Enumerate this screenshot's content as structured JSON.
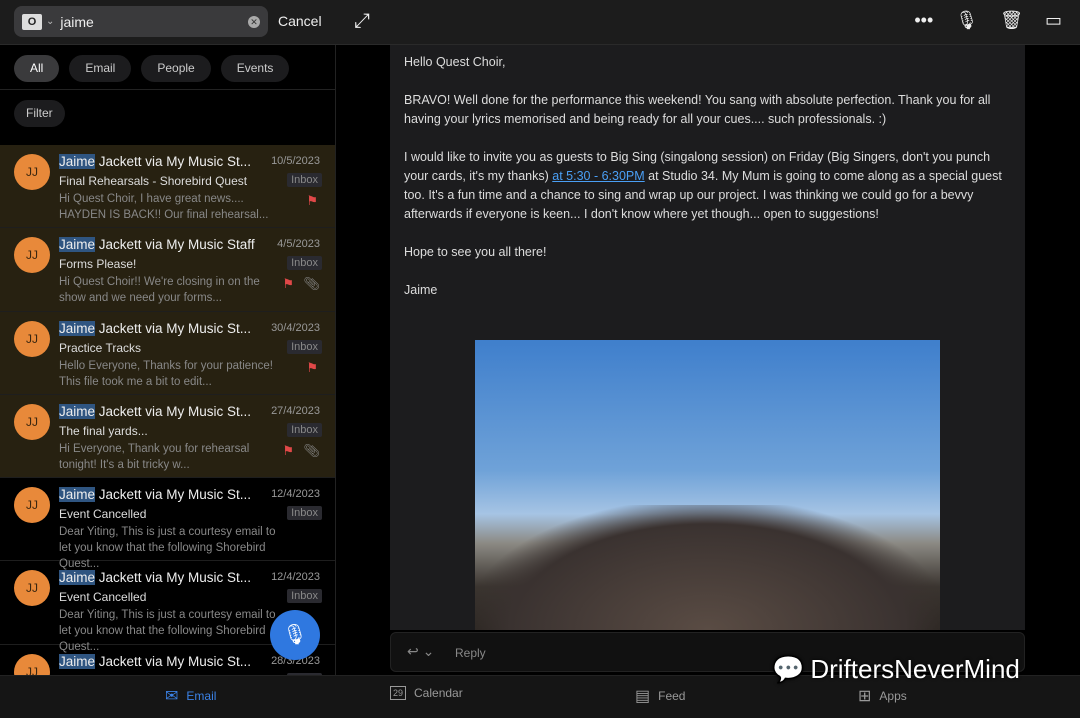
{
  "search": {
    "query": "jaime",
    "cancel": "Cancel"
  },
  "chips": [
    "All",
    "Email",
    "People",
    "Events"
  ],
  "filter": "Filter",
  "emails": [
    {
      "initials": "JJ",
      "match": "Jaime",
      "sender": " Jackett via My Music St...",
      "date": "10/5/2023",
      "subject": "Final Rehearsals  - Shorebird Quest",
      "folder": "Inbox",
      "preview": "Hi Quest Choir, I have great news.... HAYDEN IS BACK!! Our final rehearsal...",
      "flag": true,
      "attach": false,
      "highlight": true
    },
    {
      "initials": "JJ",
      "match": "Jaime",
      "sender": " Jackett via My Music Staff",
      "date": "4/5/2023",
      "subject": "Forms Please!",
      "folder": "Inbox",
      "preview": "Hi Quest Choir!! We're closing in on the show and we need your forms...",
      "flag": true,
      "attach": true,
      "highlight": true
    },
    {
      "initials": "JJ",
      "match": "Jaime",
      "sender": " Jackett via My Music St...",
      "date": "30/4/2023",
      "subject": "Practice Tracks",
      "folder": "Inbox",
      "preview": "Hello Everyone, Thanks for your patience! This file took me a bit to edit...",
      "flag": true,
      "attach": false,
      "highlight": true
    },
    {
      "initials": "JJ",
      "match": "Jaime",
      "sender": " Jackett via My Music St...",
      "date": "27/4/2023",
      "subject": "The final yards...",
      "folder": "Inbox",
      "preview": "Hi Everyone, Thank you for rehearsal tonight! It's a bit tricky w...",
      "flag": true,
      "attach": true,
      "highlight": true
    },
    {
      "initials": "JJ",
      "match": "Jaime",
      "sender": " Jackett via My Music St...",
      "date": "12/4/2023",
      "subject": "Event Cancelled",
      "folder": "Inbox",
      "preview": "Dear Yiting, This is just a courtesy email to let you know that the following Shorebird Quest...",
      "flag": false,
      "attach": false,
      "highlight": false
    },
    {
      "initials": "JJ",
      "match": "Jaime",
      "sender": " Jackett via My Music St...",
      "date": "12/4/2023",
      "subject": "Event Cancelled",
      "folder": "Inbox",
      "preview": "Dear Yiting, This is just a courtesy email to let you know that the following Shorebird Quest...",
      "flag": false,
      "attach": false,
      "highlight": false
    },
    {
      "initials": "JJ",
      "match": "Jaime",
      "sender": " Jackett via My Music St...",
      "date": "28/3/2023",
      "subject": "",
      "folder": "Inbox",
      "preview": "",
      "flag": false,
      "attach": false,
      "highlight": false
    }
  ],
  "message": {
    "greeting": "Hello Quest Choir,",
    "p1": "BRAVO!  Well done for the performance this weekend!  You sang with absolute perfection.  Thank you for all having your lyrics memorised and being ready for all your cues.... such professionals.  :)",
    "p2a": "I would like to invite you as guests to Big Sing (singalong session) on Friday (Big Singers, don't you punch your cards, it's my thanks) ",
    "p2link": "at 5:30 - 6:30PM",
    "p2b": " at Studio 34. My Mum is going to come along as a special guest too.  It's a fun time and a chance to sing and wrap up our project.  I was thinking we could go for a bevvy afterwards if everyone is keen... I don't know where yet though... open to suggestions!",
    "p3": "Hope to see you all there!",
    "sign": "Jaime"
  },
  "reply": "Reply",
  "tabs": [
    {
      "label": "Email",
      "icon": "mail-icon"
    },
    {
      "label": "Calendar",
      "icon": "calendar-icon",
      "day": "29"
    },
    {
      "label": "Feed",
      "icon": "feed-icon"
    },
    {
      "label": "Apps",
      "icon": "apps-icon"
    }
  ],
  "watermark": "DriftersNeverMind",
  "colors": {
    "accent": "#3b82e6",
    "avatar": "#e8893a",
    "flag": "#e04848",
    "highlight": "#272111"
  }
}
